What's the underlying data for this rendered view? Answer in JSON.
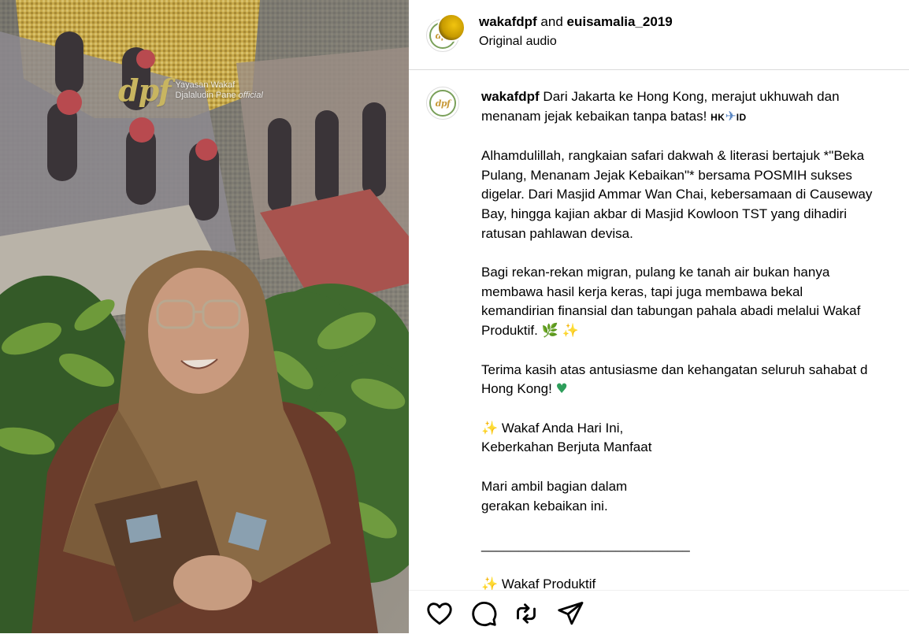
{
  "media": {
    "watermark": {
      "logo": "dpf",
      "line1": "Yayasan Wakaf",
      "line2": "Djalaludin Pane",
      "line2_suffix": "official"
    }
  },
  "header": {
    "author": "wakafdpf",
    "conjunction": "and",
    "collaborator": "euisamalia_2019",
    "audio": "Original audio"
  },
  "caption": {
    "author": "wakafdpf",
    "intro_line1": "Dari Jakarta ke Hong Kong, merajut ukhuwah dan",
    "intro_line2": "menanam jejak kebaikan tanpa batas!",
    "flag_from": "HK",
    "flag_to": "ID",
    "para2": [
      "Alhamdulillah, rangkaian safari dakwah & literasi bertajuk *\"Beka",
      "Pulang, Menanam Jejak Kebaikan\"* bersama POSMIH sukses",
      "digelar. Dari Masjid Ammar Wan Chai, kebersamaan di Causeway",
      "Bay, hingga kajian akbar di Masjid Kowloon TST yang dihadiri",
      "ratusan pahlawan devisa."
    ],
    "para3": [
      "Bagi rekan-rekan migran, pulang ke tanah air bukan hanya",
      "membawa hasil kerja keras, tapi juga membawa bekal",
      "kemandirian finansial dan tabungan pahala abadi melalui Wakaf"
    ],
    "para3_last": "Produktif.",
    "para4_line1": "Terima kasih atas antusiasme dan kehangatan seluruh sahabat d",
    "para4_line2": "Hong Kong!",
    "para5_line1": "Wakaf Anda Hari Ini,",
    "para5_line2": "Keberkahan Berjuta Manfaat",
    "para6_line1": "Mari ambil bagian dalam",
    "para6_line2": "gerakan kebaikan ini.",
    "divider": "____________________________",
    "para7_line1": "Wakaf Produktif"
  },
  "actions": {
    "like_icon": "heart-icon",
    "comment_icon": "comment-icon",
    "repost_icon": "repost-icon",
    "share_icon": "share-icon"
  },
  "colors": {
    "text": "#000000",
    "divider": "#dbdbdb",
    "logo_gold": "#c8b560",
    "heart_green": "#2e9e5b"
  }
}
